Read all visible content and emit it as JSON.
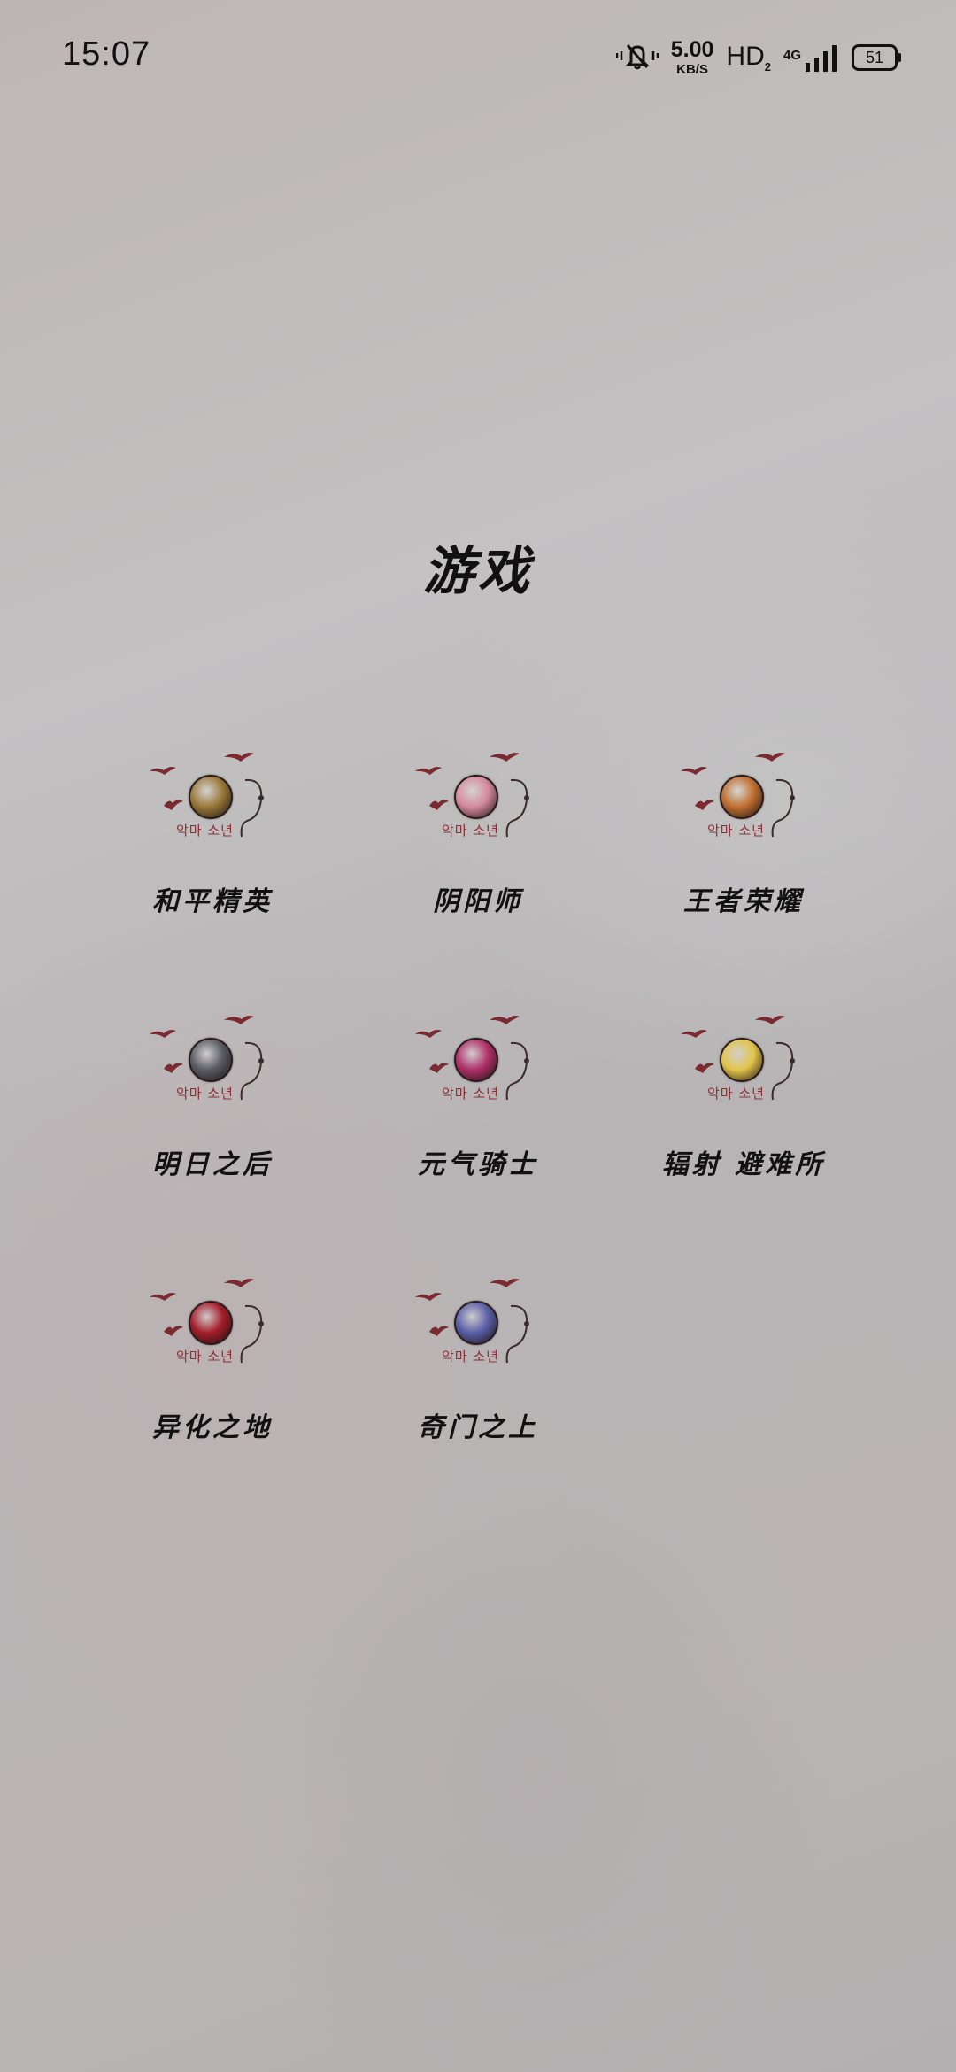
{
  "status_bar": {
    "time": "15:07",
    "speed_value": "5.00",
    "speed_unit": "KB/S",
    "hd_label": "HD",
    "hd_sub": "2",
    "network": "4G",
    "battery": "51",
    "icons": [
      "mute-bell-icon",
      "signal-icon",
      "battery-icon"
    ]
  },
  "title": "游戏",
  "emblem_text": "악마 소년",
  "colors": {
    "emblem_text": "#8c2f36",
    "birds": "#7a2a30"
  },
  "games": [
    {
      "label": "和平精英",
      "icon": "peace-elite-avatar",
      "color": "#9a7a3a"
    },
    {
      "label": "阴阳师",
      "icon": "onmyoji-avatar",
      "color": "#d48aa0"
    },
    {
      "label": "王者荣耀",
      "icon": "honor-of-kings-avatar",
      "color": "#c07030"
    },
    {
      "label": "明日之后",
      "icon": "lifeafter-avatar",
      "color": "#5a5d63"
    },
    {
      "label": "元气骑士",
      "icon": "soul-knight-avatar",
      "color": "#b0306a"
    },
    {
      "label": "辐射 避难所",
      "icon": "fallout-shelter-avatar",
      "color": "#e2c64a"
    },
    {
      "label": "异化之地",
      "icon": "alien-land-avatar",
      "color": "#a41e2a"
    },
    {
      "label": "奇门之上",
      "icon": "qimen-avatar",
      "color": "#5a5fa8"
    }
  ]
}
